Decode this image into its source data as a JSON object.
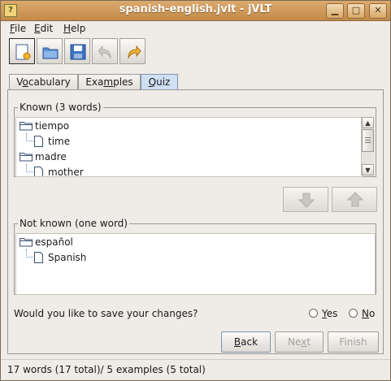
{
  "window": {
    "title": "spanish-english.jvlt - jVLT",
    "app_icon": "?",
    "controls": {
      "minimize": "▁",
      "maximize": "□",
      "close": "✕"
    }
  },
  "menu": {
    "items": [
      {
        "accel": "F",
        "rest": "ile"
      },
      {
        "accel": "E",
        "rest": "dit"
      },
      {
        "accel": "H",
        "rest": "elp"
      }
    ]
  },
  "toolbar": {
    "icons": [
      "new-file-icon",
      "open-folder-icon",
      "save-disk-icon",
      "undo-arrow-icon",
      "redo-arrow-icon"
    ]
  },
  "tabs": [
    {
      "pre": "V",
      "accel": "o",
      "post": "cabulary",
      "active": false
    },
    {
      "pre": "Exa",
      "accel": "m",
      "post": "ples",
      "active": false
    },
    {
      "pre": "",
      "accel": "Q",
      "post": "uiz",
      "active": true
    }
  ],
  "known": {
    "title": "Known (3 words)",
    "items": [
      {
        "word": "tiempo",
        "translation": "time"
      },
      {
        "word": "madre",
        "translation": "mother"
      }
    ]
  },
  "move_buttons": {
    "down": "arrow-down-icon",
    "up": "arrow-up-icon"
  },
  "not_known": {
    "title": "Not known (one word)",
    "items": [
      {
        "word": "español",
        "translation": "Spanish"
      }
    ]
  },
  "save_prompt": {
    "question": "Would you like to save your changes?",
    "yes": {
      "accel": "Y",
      "rest": "es"
    },
    "no": {
      "accel": "N",
      "rest": "o"
    }
  },
  "buttons": {
    "back": {
      "accel": "B",
      "rest": "ack"
    },
    "next": {
      "pre": "Ne",
      "accel": "x",
      "post": "t"
    },
    "finish": "Finish"
  },
  "status": "17 words (17 total)/ 5 examples (5 total)",
  "colors": {
    "titlebar": "#c48a48",
    "active_tab": "#cfe0f4",
    "tree_line": "#6a8ab8"
  }
}
